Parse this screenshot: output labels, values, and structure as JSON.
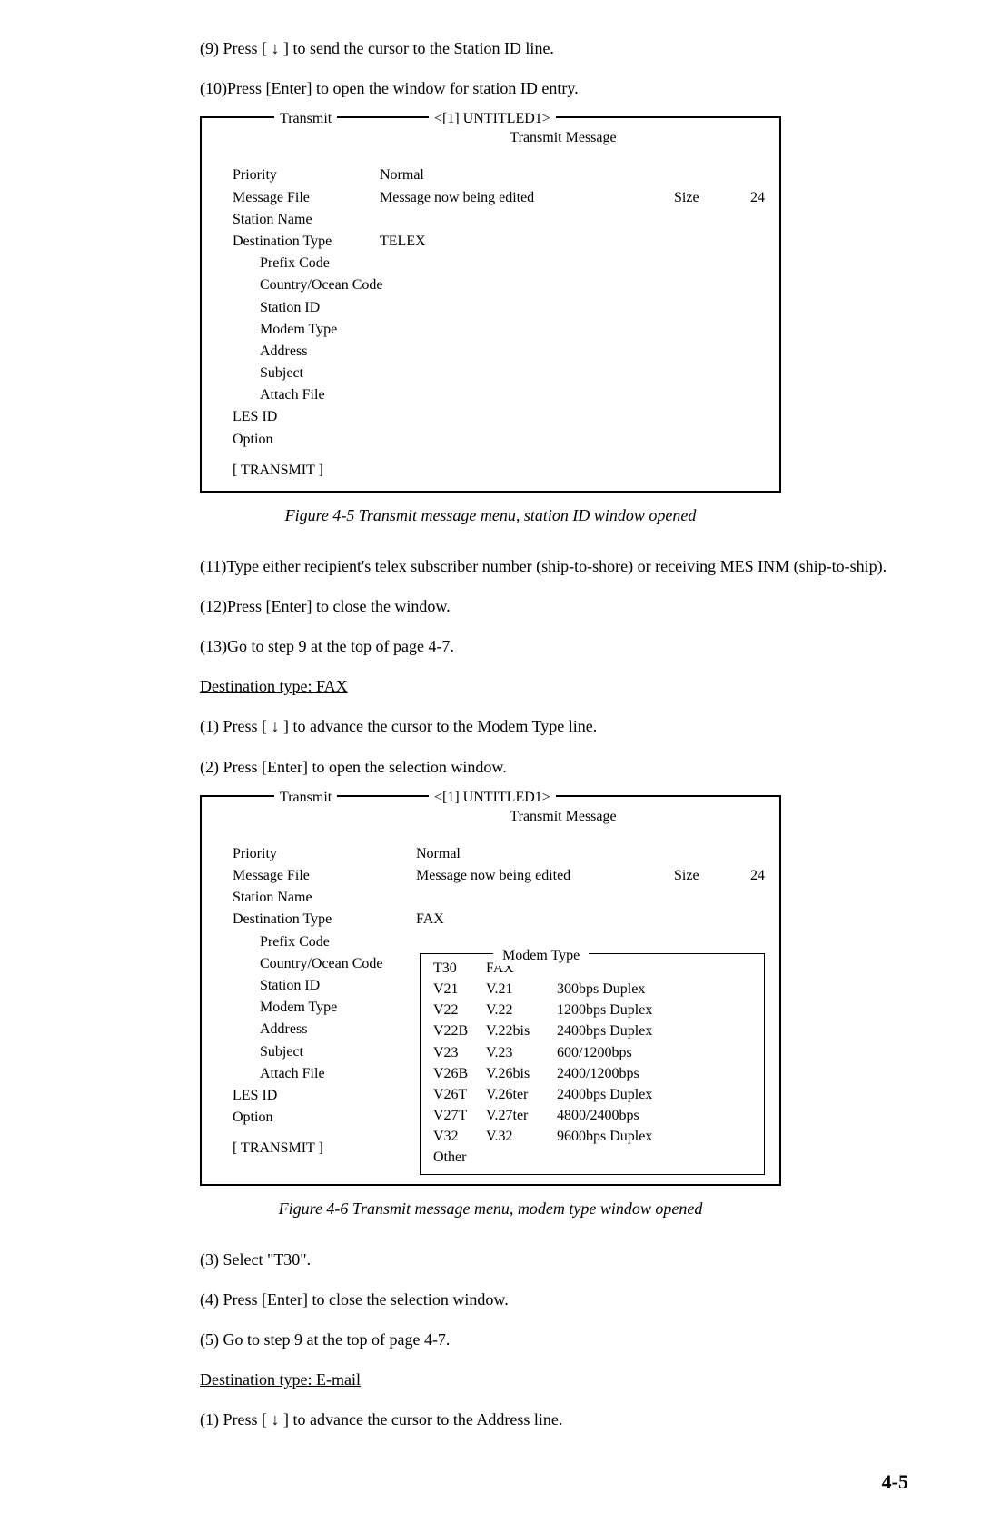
{
  "steps_a": {
    "s9": "(9)  Press [ ↓ ] to send the cursor to the Station ID line.",
    "s10": "(10)Press [Enter] to open the window for station ID entry."
  },
  "term1": {
    "transmit": "Transmit",
    "title": "<[1] UNTITLED1>",
    "sub": "Transmit Message",
    "priority_l": "Priority",
    "priority_v": "Normal",
    "msgfile_l": "Message File",
    "msgfile_v": "Message now being edited",
    "size_h": "Size",
    "size_v": "24",
    "station_name": "Station Name",
    "desttype_l": "Destination Type",
    "desttype_v": "TELEX",
    "prefix": "Prefix Code",
    "country": "Country/Ocean Code",
    "stid": "Station ID",
    "modem": "Modem Type",
    "addr": "Address",
    "subj": "Subject",
    "attach": "Attach File",
    "les": "LES ID",
    "option": "Option",
    "btn": "[ TRANSMIT ]"
  },
  "fig45": "Figure 4-5 Transmit message menu, station ID window opened",
  "steps_b": {
    "s11": "(11)Type either recipient's telex subscriber number (ship-to-shore) or receiving MES INM (ship-to-ship).",
    "s12": "(12)Press [Enter] to close the window.",
    "s13": "(13)Go to step 9 at the top of page 4-7."
  },
  "hdr_fax": "Destination type: FAX",
  "steps_c": {
    "s1": "(1)  Press [ ↓ ] to advance the cursor to the Modem Type line.",
    "s2": "(2)  Press [Enter] to open the selection window."
  },
  "term2": {
    "transmit": "Transmit",
    "title": "<[1] UNTITLED1>",
    "sub": "Transmit Message",
    "priority_l": "Priority",
    "priority_v": "Normal",
    "msgfile_l": "Message File",
    "msgfile_v": "Message now being edited",
    "size_h": "Size",
    "size_v": "24",
    "station_name": "Station Name",
    "desttype_l": "Destination Type",
    "desttype_v": "FAX",
    "prefix": "Prefix Code",
    "country": "Country/Ocean Code",
    "stid": "Station ID",
    "modem": "Modem Type",
    "addr": "Address",
    "subj": "Subject",
    "attach": "Attach File",
    "les": "LES ID",
    "option": "Option",
    "btn": "[ TRANSMIT ]",
    "modem_title": "Modem Type",
    "modem_rows": [
      {
        "c1": "T30",
        "c2": "FAX",
        "c3": ""
      },
      {
        "c1": "V21",
        "c2": "V.21",
        "c3": "300bps Duplex"
      },
      {
        "c1": "V22",
        "c2": "V.22",
        "c3": "1200bps Duplex"
      },
      {
        "c1": "V22B",
        "c2": "V.22bis",
        "c3": "2400bps Duplex"
      },
      {
        "c1": "V23",
        "c2": "V.23",
        "c3": "600/1200bps"
      },
      {
        "c1": "V26B",
        "c2": "V.26bis",
        "c3": "2400/1200bps"
      },
      {
        "c1": "V26T",
        "c2": "V.26ter",
        "c3": "2400bps Duplex"
      },
      {
        "c1": "V27T",
        "c2": "V.27ter",
        "c3": "4800/2400bps"
      },
      {
        "c1": "V32",
        "c2": "V.32",
        "c3": "9600bps Duplex"
      },
      {
        "c1": "Other",
        "c2": "",
        "c3": ""
      }
    ]
  },
  "fig46": "Figure 4-6 Transmit message menu, modem type window opened",
  "steps_d": {
    "s3": "(3)  Select \"T30\".",
    "s4": "(4)  Press [Enter] to close the selection window.",
    "s5": "(5)  Go to step 9 at the top of page 4-7."
  },
  "hdr_email": "Destination type: E-mail",
  "steps_e": {
    "s1": "(1)  Press [ ↓ ] to advance the cursor to the Address line."
  },
  "pageno": "4-5"
}
